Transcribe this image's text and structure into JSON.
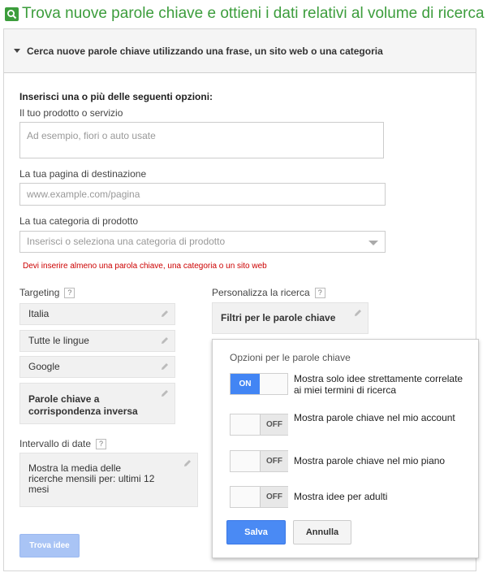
{
  "header": {
    "title": "Trova nuove parole chiave e ottieni i dati relativi al volume di ricerca",
    "accent": "#3c9d3c"
  },
  "section": {
    "title": "Cerca nuove parole chiave utilizzando una frase, un sito web o una categoria"
  },
  "form": {
    "intro": "Inserisci una o più delle seguenti opzioni:",
    "product_label": "Il tuo prodotto o servizio",
    "product_placeholder": "Ad esempio, fiori o auto usate",
    "landing_label": "La tua pagina di destinazione",
    "landing_placeholder": "www.example.com/pagina",
    "category_label": "La tua categoria di prodotto",
    "category_placeholder": "Inserisci o seleziona una categoria di prodotto",
    "error": "Devi inserire almeno una parola chiave, una categoria o un sito web"
  },
  "targeting": {
    "label": "Targeting",
    "help": "?",
    "items": [
      "Italia",
      "Tutte le lingue",
      "Google"
    ],
    "negative": "Parole chiave a corrispondenza inversa"
  },
  "dates": {
    "label": "Intervallo di date",
    "help": "?",
    "value": "Mostra la media delle ricerche mensili per: ultimi 12 mesi"
  },
  "customize": {
    "label": "Personalizza la ricerca",
    "help": "?",
    "filter": "Filtri per le parole chiave"
  },
  "options": {
    "title": "Opzioni per le parole chiave",
    "on_text": "ON",
    "off_text": "OFF",
    "toggles": [
      {
        "label": "Mostra solo idee strettamente correlate ai miei termini di ricerca",
        "state": "on"
      },
      {
        "label": "Mostra parole chiave nel mio account",
        "state": "off"
      },
      {
        "label": "Mostra parole chiave nel mio piano",
        "state": "off"
      },
      {
        "label": "Mostra idee per adulti",
        "state": "off"
      }
    ],
    "save": "Salva",
    "cancel": "Annulla"
  },
  "submit": {
    "label": "Trova idee"
  }
}
